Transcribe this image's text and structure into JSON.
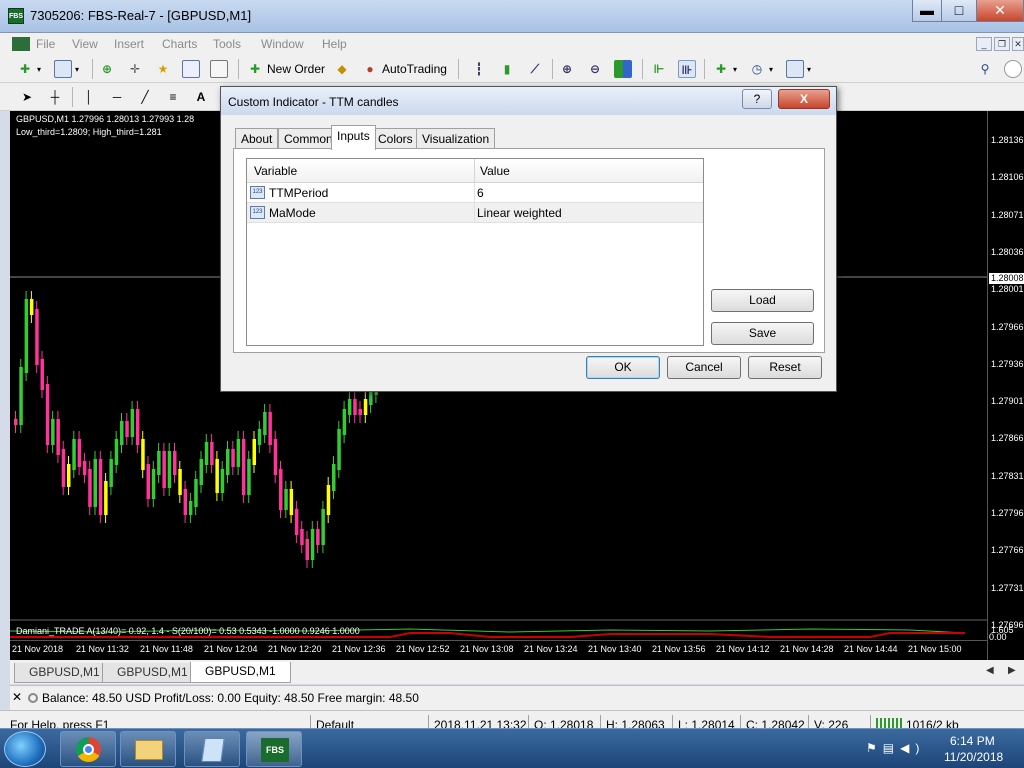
{
  "window": {
    "title": "7305206: FBS-Real-7 - [GBPUSD,M1]",
    "app_icon": "FBS"
  },
  "menu": [
    "File",
    "View",
    "Insert",
    "Charts",
    "Tools",
    "Window",
    "Help"
  ],
  "toolbar": {
    "new_order": "New Order",
    "autotrading": "AutoTrading"
  },
  "chart": {
    "info_line": "GBPUSD,M1  1.27996 1.28013 1.27993 1.28",
    "thirds_line": "Low_third=1.2809; High_third=1.281",
    "price_ticks": [
      "1.28136",
      "1.28106",
      "1.28071",
      "1.28036",
      "1.28001",
      "1.27966",
      "1.27936",
      "1.27901",
      "1.27866",
      "1.27831",
      "1.27796",
      "1.27766",
      "1.27731",
      "1.27696"
    ],
    "current_price": "1.28008",
    "time_ticks": [
      "21 Nov 2018",
      "21 Nov 11:32",
      "21 Nov 11:48",
      "21 Nov 12:04",
      "21 Nov 12:20",
      "21 Nov 12:36",
      "21 Nov 12:52",
      "21 Nov 13:08",
      "21 Nov 13:24",
      "21 Nov 13:40",
      "21 Nov 13:56",
      "21 Nov 14:12",
      "21 Nov 14:28",
      "21 Nov 14:44",
      "21 Nov 15:00"
    ],
    "subwindow_label": "Damiani_TRADE  A(13/40)= 0.92, 1.4 - S(20/100)= 0.53  0.5343 -1.0000 0.9246 1.0000",
    "subwindow_axis_top": "1.605",
    "subwindow_axis_bottom": "0.00",
    "candle_colors": {
      "up": "#33cc33",
      "down": "#ff3399",
      "neutral": "#ffff00"
    }
  },
  "chart_tabs": [
    "GBPUSD,M1",
    "GBPUSD,M1",
    "GBPUSD,M1"
  ],
  "terminal": {
    "balance": "Balance: 48.50 USD  Profit/Loss: 0.00  Equity: 48.50  Free margin: 48.50"
  },
  "status": {
    "help": "For Help, press F1",
    "profile": "Default",
    "datetime": "2018.11.21 13:32",
    "open": "O: 1.28018",
    "high": "H: 1.28063",
    "low": "L: 1.28014",
    "close": "C: 1.28042",
    "volume": "V: 226",
    "traffic": "1016/2 kb"
  },
  "taskbar": {
    "time": "6:14 PM",
    "date": "11/20/2018",
    "fbs_label": "FBS"
  },
  "dialog": {
    "title": "Custom Indicator - TTM candles",
    "help": "?",
    "close": "X",
    "tabs": [
      "About",
      "Common",
      "Inputs",
      "Colors",
      "Visualization"
    ],
    "active_tab": "Inputs",
    "grid": {
      "headers": {
        "variable": "Variable",
        "value": "Value"
      },
      "rows": [
        {
          "icon": "123",
          "name": "TTMPeriod",
          "value": "6"
        },
        {
          "icon": "123",
          "name": "MaMode",
          "value": "Linear weighted"
        }
      ]
    },
    "buttons": {
      "load": "Load",
      "save": "Save",
      "ok": "OK",
      "cancel": "Cancel",
      "reset": "Reset"
    }
  }
}
